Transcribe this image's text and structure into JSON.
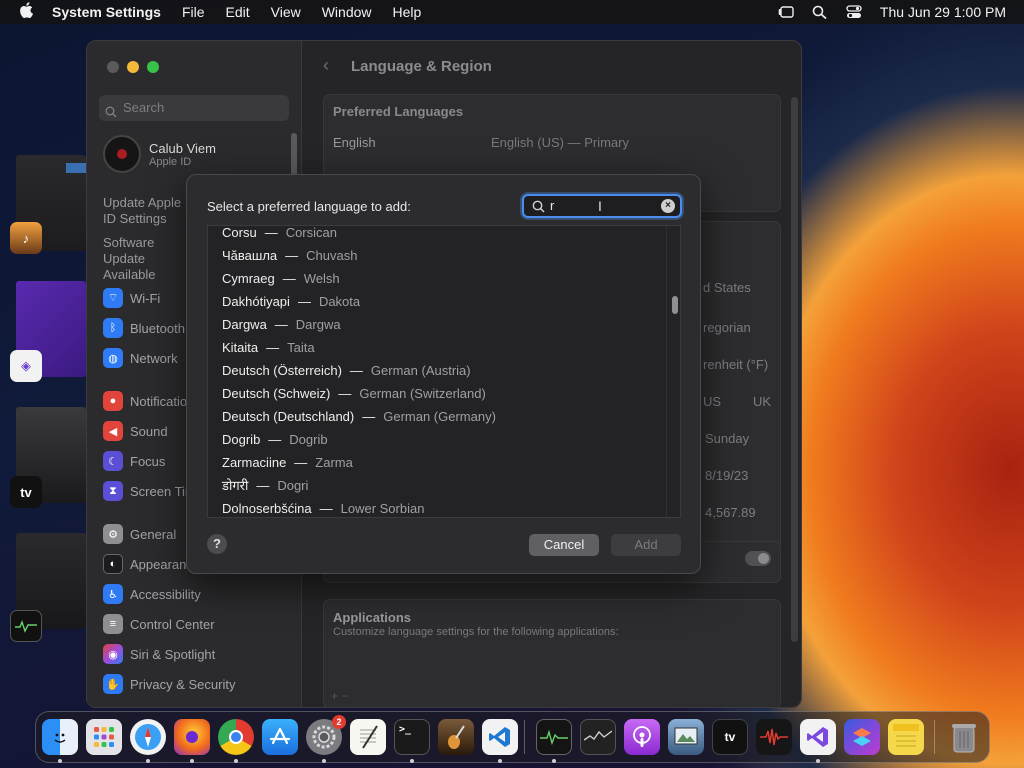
{
  "menubar": {
    "app_name": "System Settings",
    "menus": [
      "File",
      "Edit",
      "View",
      "Window",
      "Help"
    ],
    "datetime": "Thu Jun 29  1:00 PM"
  },
  "stage_apps": [
    {
      "name": "GarageBand",
      "icon": "guitar-icon",
      "label": ""
    },
    {
      "name": "Visual Studio",
      "icon": "visual-studio-icon",
      "label": ""
    },
    {
      "name": "Apple TV",
      "icon": "apple-tv-icon",
      "label": "tv"
    },
    {
      "name": "Activity Monitor",
      "icon": "activity-monitor-icon",
      "label": ""
    }
  ],
  "settings": {
    "search_placeholder": "Search",
    "account": {
      "name": "Calub Viem",
      "subtitle": "Apple ID"
    },
    "update_notice": "Update Apple ID Settings",
    "software_update": "Software Update Available",
    "items": [
      {
        "label": "Wi-Fi",
        "icon": "wifi-icon",
        "color": "#2f7bf5"
      },
      {
        "label": "Bluetooth",
        "icon": "bluetooth-icon",
        "color": "#2f7bf5"
      },
      {
        "label": "Network",
        "icon": "globe-icon",
        "color": "#2f7bf5"
      },
      {
        "label": "Notifications",
        "icon": "bell-icon",
        "color": "#e0443a"
      },
      {
        "label": "Sound",
        "icon": "speaker-icon",
        "color": "#e0443a"
      },
      {
        "label": "Focus",
        "icon": "moon-icon",
        "color": "#5b4fd6"
      },
      {
        "label": "Screen Time",
        "icon": "hourglass-icon",
        "color": "#5b4fd6"
      },
      {
        "label": "General",
        "icon": "gear-icon",
        "color": "#8e8e93"
      },
      {
        "label": "Appearance",
        "icon": "appearance-icon",
        "color": "#1c1c1e"
      },
      {
        "label": "Accessibility",
        "icon": "accessibility-icon",
        "color": "#2f7bf5"
      },
      {
        "label": "Control Center",
        "icon": "control-center-icon",
        "color": "#8e8e93"
      },
      {
        "label": "Siri & Spotlight",
        "icon": "siri-icon",
        "color": "#a04bd8"
      },
      {
        "label": "Privacy & Security",
        "icon": "hand-icon",
        "color": "#2f7bf5"
      }
    ],
    "page_title": "Language & Region",
    "preferred_languages_title": "Preferred Languages",
    "language_row": {
      "name": "English",
      "detail": "English (US) — Primary"
    },
    "region_value": "d States",
    "calendar_value": "regorian",
    "temperature_value": "renheit (°F)",
    "measurement_us": "US",
    "measurement_uk": "UK",
    "first_day_value": "Sunday",
    "date_format_value": "8/19/23",
    "number_format_value": "4,567.89",
    "applications_title": "Applications",
    "applications_subtitle": "Customize language settings for the following applications:",
    "add_remove": "+  −"
  },
  "modal": {
    "prompt": "Select a preferred language to add:",
    "search_value": "r",
    "languages": [
      {
        "native": "Corsu",
        "english": "Corsican"
      },
      {
        "native": "Чӑвашла",
        "english": "Chuvash"
      },
      {
        "native": "Cymraeg",
        "english": "Welsh"
      },
      {
        "native": "Dakhótiyapi",
        "english": "Dakota"
      },
      {
        "native": "Dargwa",
        "english": "Dargwa"
      },
      {
        "native": "Kitaita",
        "english": "Taita"
      },
      {
        "native": "Deutsch (Österreich)",
        "english": "German (Austria)"
      },
      {
        "native": "Deutsch (Schweiz)",
        "english": "German (Switzerland)"
      },
      {
        "native": "Deutsch (Deutschland)",
        "english": "German (Germany)"
      },
      {
        "native": "Dogrib",
        "english": "Dogrib"
      },
      {
        "native": "Zarmaciine",
        "english": "Zarma"
      },
      {
        "native": "डोगरी",
        "english": "Dogri"
      },
      {
        "native": "Dolnoserbšćina",
        "english": "Lower Sorbian"
      }
    ],
    "separator": "—",
    "help_label": "?",
    "cancel_label": "Cancel",
    "add_label": "Add"
  },
  "dock": [
    {
      "name": "Finder",
      "icon": "finder-icon",
      "color": "#2b8ff5",
      "label": ""
    },
    {
      "name": "Launchpad",
      "icon": "launchpad-icon",
      "color": "#d8d8dc",
      "label": ""
    },
    {
      "name": "Safari",
      "icon": "safari-icon",
      "color": "#3aa0f5",
      "label": ""
    },
    {
      "name": "Firefox",
      "icon": "firefox-icon",
      "color": "#f06a1c",
      "label": ""
    },
    {
      "name": "Chrome",
      "icon": "chrome-icon",
      "color": "#34a853",
      "label": ""
    },
    {
      "name": "App Store",
      "icon": "app-store-icon",
      "color": "#1c8cf5",
      "label": ""
    },
    {
      "name": "System Settings",
      "icon": "settings-gear-icon",
      "color": "#7b7b80",
      "label": "",
      "badge": "2"
    },
    {
      "name": "TextEdit",
      "icon": "textedit-icon",
      "color": "#f2f2f2",
      "label": ""
    },
    {
      "name": "Terminal",
      "icon": "terminal-icon",
      "color": "#1a1a1a",
      "label": ">_"
    },
    {
      "name": "GarageBand",
      "icon": "guitar-icon",
      "color": "#4a3a2a",
      "label": ""
    },
    {
      "name": "VS Code",
      "icon": "vscode-icon",
      "color": "#1e78d2",
      "label": ""
    },
    {
      "name": "Activity Monitor",
      "icon": "activity-monitor-icon",
      "color": "#1a1a1a",
      "label": ""
    },
    {
      "name": "Stocks",
      "icon": "stocks-icon",
      "color": "#2a2a2a",
      "label": ""
    },
    {
      "name": "Podcasts",
      "icon": "podcasts-icon",
      "color": "#9c45e0",
      "label": ""
    },
    {
      "name": "Preview",
      "icon": "preview-icon",
      "color": "#5a7aa0",
      "label": ""
    },
    {
      "name": "Apple TV",
      "icon": "apple-tv-icon",
      "color": "#111111",
      "label": "tv"
    },
    {
      "name": "Voice Memos",
      "icon": "voice-memos-icon",
      "color": "#1a1a1a",
      "label": ""
    },
    {
      "name": "Visual Studio",
      "icon": "visual-studio-icon",
      "color": "#f2f2f2",
      "label": ""
    },
    {
      "name": "Shortcuts",
      "icon": "shortcuts-icon",
      "color": "#5b3fd0",
      "label": ""
    },
    {
      "name": "Notes",
      "icon": "notes-icon",
      "color": "#f5d74a",
      "label": ""
    },
    {
      "name": "Trash",
      "icon": "trash-icon",
      "color": "#6a6a6e",
      "label": ""
    }
  ]
}
